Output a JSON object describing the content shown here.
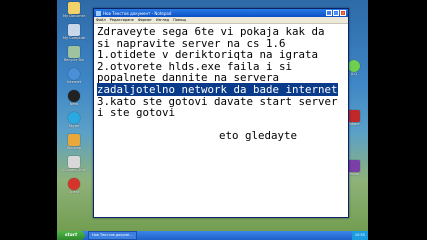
{
  "window": {
    "title": "Нов Текстов документ - Notepad",
    "menu": [
      "Файл",
      "Редактиране",
      "Формат",
      "Изглед",
      "Помощ"
    ]
  },
  "document": {
    "lines": [
      "Zdraveyte sega 6te vi pokaja kak da",
      "si napravite server na cs 1.6",
      "1.otidete v deriktoriqta na igrata",
      "2.otvorete hlds.exe faila i si",
      "popalnete dannite na servera",
      "zadaljotelno network da bade internet",
      "3.kato ste gotovi davate start server",
      "i ste gotovi"
    ],
    "selected_line_index": 5,
    "signature": "eto gledayte"
  },
  "desktop": {
    "icons": [
      "My Documents",
      "My Computer",
      "Recycle Bin",
      "Internet",
      "Nero",
      "Skype",
      "Winamp",
      "Counter-Strike",
      "Opera",
      "ICQ",
      "Adobe",
      "Yahoo"
    ]
  },
  "taskbar": {
    "start_label": "start",
    "tasks": [
      "Нов Текстов докуме..."
    ],
    "clock": "10:55"
  }
}
